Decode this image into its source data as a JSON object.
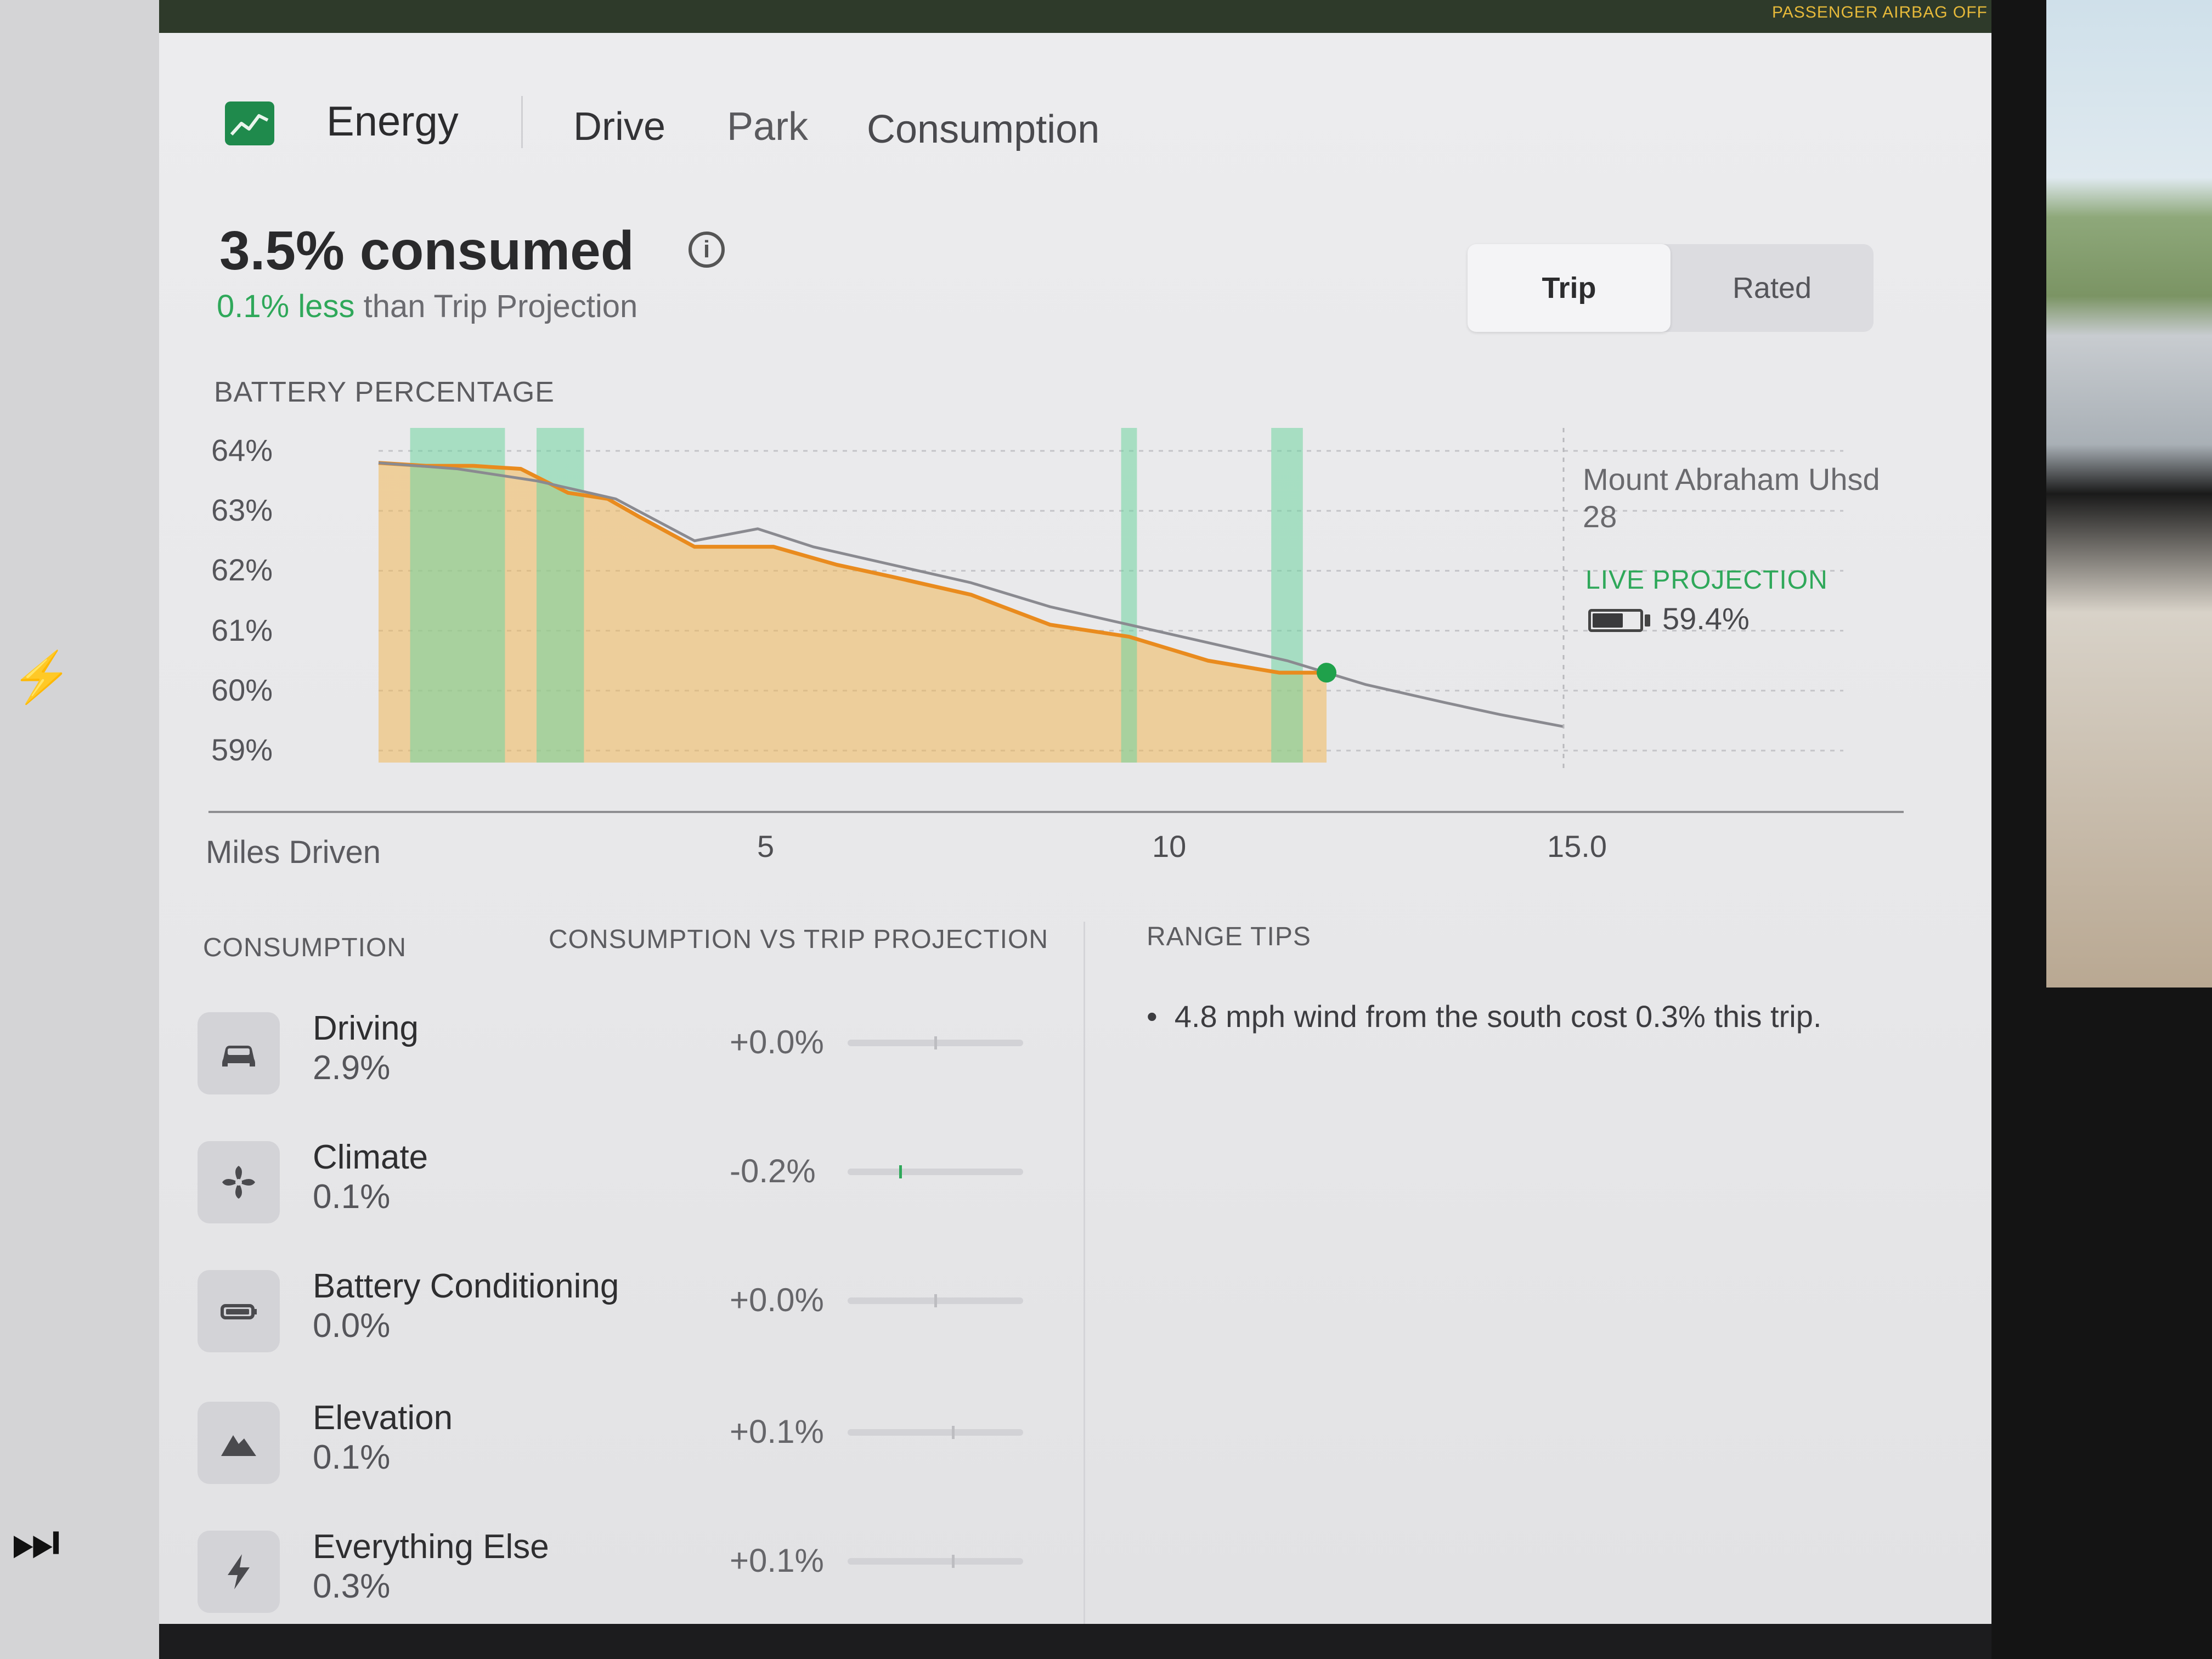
{
  "status_bar": {
    "airbag_label": "PASSENGER AIRBAG OFF"
  },
  "header": {
    "app_title": "Energy",
    "tabs": [
      {
        "label": "Drive",
        "active": false
      },
      {
        "label": "Park",
        "active": false
      },
      {
        "label": "Consumption",
        "active": false
      }
    ]
  },
  "summary": {
    "consumed": "3.5% consumed",
    "delta_green": "0.1% less",
    "delta_rest": " than Trip Projection"
  },
  "toggle": {
    "options": [
      "Trip",
      "Rated"
    ],
    "selected": "Trip"
  },
  "chart_data": {
    "type": "line",
    "title": "BATTERY PERCENTAGE",
    "xlabel": "Miles Driven",
    "ylabel": "",
    "y_ticks": [
      "64%",
      "63%",
      "62%",
      "61%",
      "60%",
      "59%"
    ],
    "x_ticks": [
      "5",
      "10",
      "15.0"
    ],
    "xlim": [
      0,
      15.0
    ],
    "ylim": [
      58.8,
      64.2
    ],
    "series": [
      {
        "color": "#e98b1e",
        "x": [
          0,
          0.6,
          1.2,
          1.8,
          2.4,
          2.9,
          3.3,
          4.0,
          5.0,
          5.8,
          6.5,
          7.5,
          8.5,
          9.5,
          10.5,
          11.4,
          12.0
        ],
        "values": [
          63.8,
          63.75,
          63.75,
          63.7,
          63.3,
          63.2,
          62.9,
          62.4,
          62.4,
          62.1,
          61.9,
          61.6,
          61.1,
          60.9,
          60.5,
          60.3,
          60.3
        ]
      },
      {
        "color": "#8a8a90",
        "x": [
          0,
          1.0,
          2.0,
          3.0,
          4.0,
          4.8,
          5.5,
          6.5,
          7.5,
          8.5,
          9.5,
          10.5,
          11.5,
          12.5,
          13.5,
          14.2,
          15.0
        ],
        "values": [
          63.8,
          63.7,
          63.5,
          63.2,
          62.5,
          62.7,
          62.4,
          62.1,
          61.8,
          61.4,
          61.1,
          60.8,
          60.5,
          60.1,
          59.8,
          59.6,
          59.4
        ]
      }
    ],
    "bands": {
      "green_mile_ranges": [
        [
          0.4,
          1.6
        ],
        [
          2.0,
          2.6
        ],
        [
          9.4,
          9.6
        ],
        [
          11.3,
          11.7
        ]
      ],
      "orange_fill_range": [
        0,
        12.0
      ]
    },
    "current_point": {
      "x": 12.0,
      "y": 60.3
    },
    "destination": {
      "name": "Mount Abraham Uhsd 28",
      "x": 15.0
    },
    "grid": true
  },
  "live_projection": {
    "label": "LIVE PROJECTION",
    "value": "59.4%"
  },
  "consumption": {
    "header": "CONSUMPTION",
    "vs_header": "CONSUMPTION VS TRIP PROJECTION",
    "items": [
      {
        "label": "Driving",
        "value": "2.9%",
        "delta": "+0.0%",
        "delta_num": 0.0,
        "icon": "car-icon"
      },
      {
        "label": "Climate",
        "value": "0.1%",
        "delta": "-0.2%",
        "delta_num": -0.2,
        "icon": "fan-icon"
      },
      {
        "label": "Battery Conditioning",
        "value": "0.0%",
        "delta": "+0.0%",
        "delta_num": 0.0,
        "icon": "battery-icon"
      },
      {
        "label": "Elevation",
        "value": "0.1%",
        "delta": "+0.1%",
        "delta_num": 0.1,
        "icon": "mountain-icon"
      },
      {
        "label": "Everything Else",
        "value": "0.3%",
        "delta": "+0.1%",
        "delta_num": 0.1,
        "icon": "bolt-icon"
      }
    ]
  },
  "range_tips": {
    "header": "RANGE TIPS",
    "tips": [
      "4.8 mph wind from the south cost 0.3% this trip."
    ]
  },
  "colors": {
    "accent_green": "#2fa85a",
    "orange": "#e98b1e",
    "projection_gray": "#8a8a90"
  }
}
